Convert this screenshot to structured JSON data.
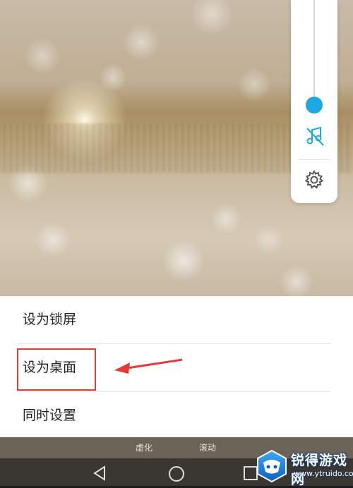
{
  "side_panel": {
    "volume_level": 0.5,
    "accent": "#1ea8e0",
    "icons": [
      "music-off-icon",
      "gear-icon"
    ]
  },
  "sheet": {
    "options": [
      {
        "label": "设为锁屏"
      },
      {
        "label": "设为桌面"
      },
      {
        "label": "同时设置"
      }
    ]
  },
  "under_bar": {
    "items": [
      "虚化",
      "滚动"
    ]
  },
  "annotation": {
    "color": "#e53935"
  },
  "watermark": {
    "title": "锐得游戏网",
    "url": "www.ytruido.com"
  },
  "navbar": {
    "icons": [
      "back-icon",
      "home-icon",
      "recent-apps-icon"
    ]
  }
}
